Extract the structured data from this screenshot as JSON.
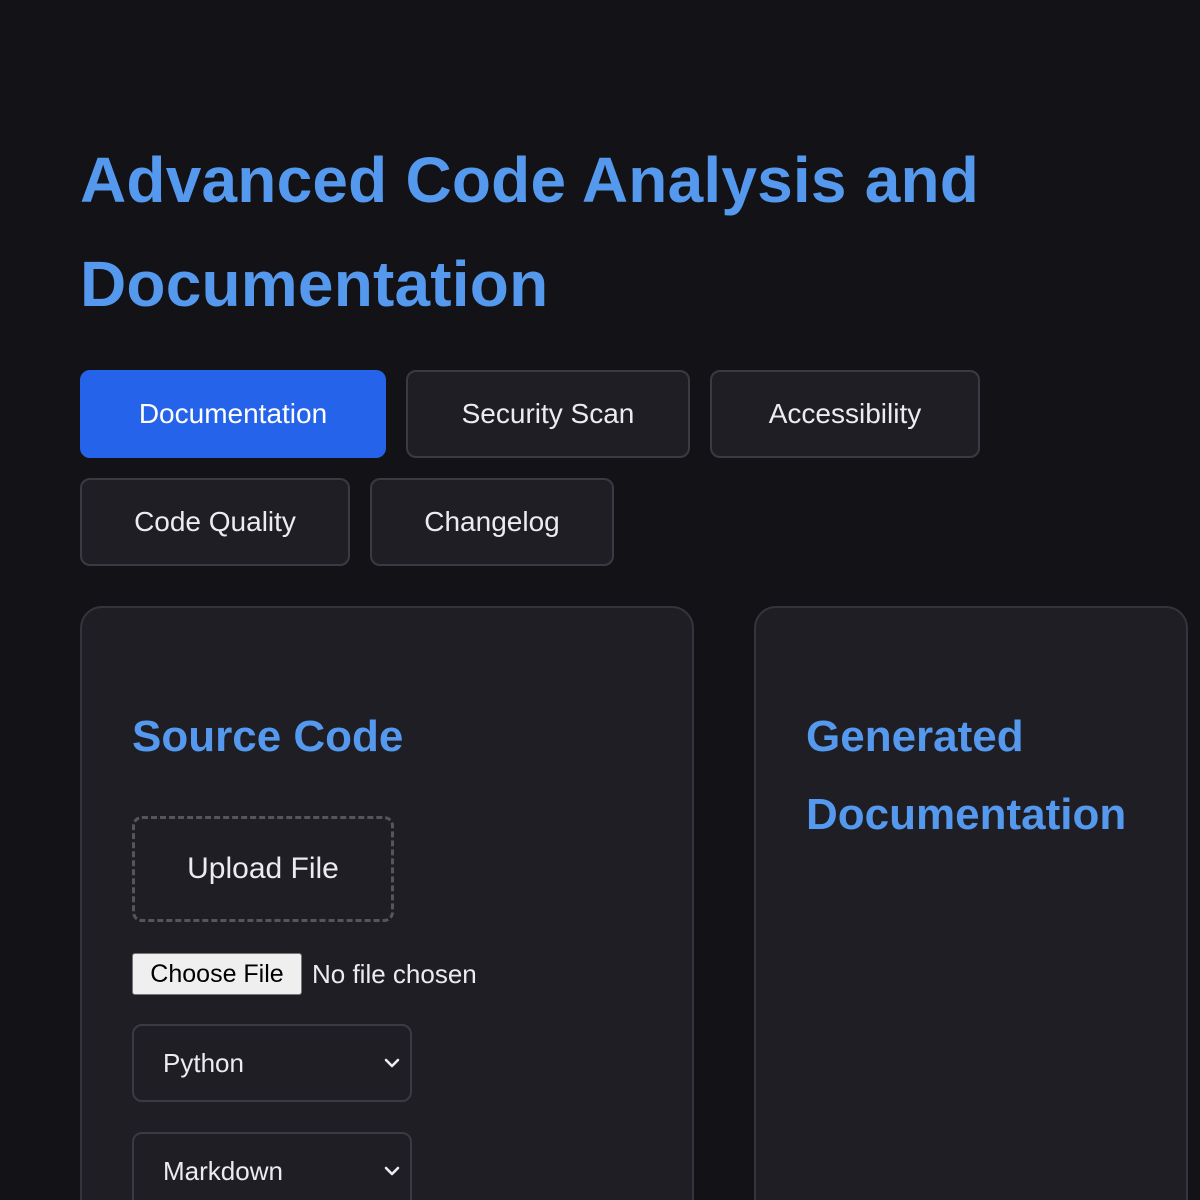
{
  "page": {
    "title": "Advanced Code Analysis and Documentation"
  },
  "tabs": [
    {
      "label": "Documentation",
      "active": true
    },
    {
      "label": "Security Scan",
      "active": false
    },
    {
      "label": "Accessibility",
      "active": false
    },
    {
      "label": "Code Quality",
      "active": false
    },
    {
      "label": "Changelog",
      "active": false
    }
  ],
  "source_panel": {
    "heading": "Source Code",
    "upload_label": "Upload File",
    "file_input": {
      "button_label": "Choose File",
      "status": "No file chosen"
    },
    "language_select": {
      "value": "Python",
      "icon": "chevron-down-icon"
    },
    "format_select": {
      "value": "Markdown",
      "icon": "chevron-down-icon"
    }
  },
  "output_panel": {
    "heading": "Generated Documentation"
  },
  "colors": {
    "background": "#131317",
    "accent": "#5599ee",
    "active_tab": "#2563eb",
    "panel": "#1e1e24",
    "border": "#3a3a42"
  }
}
